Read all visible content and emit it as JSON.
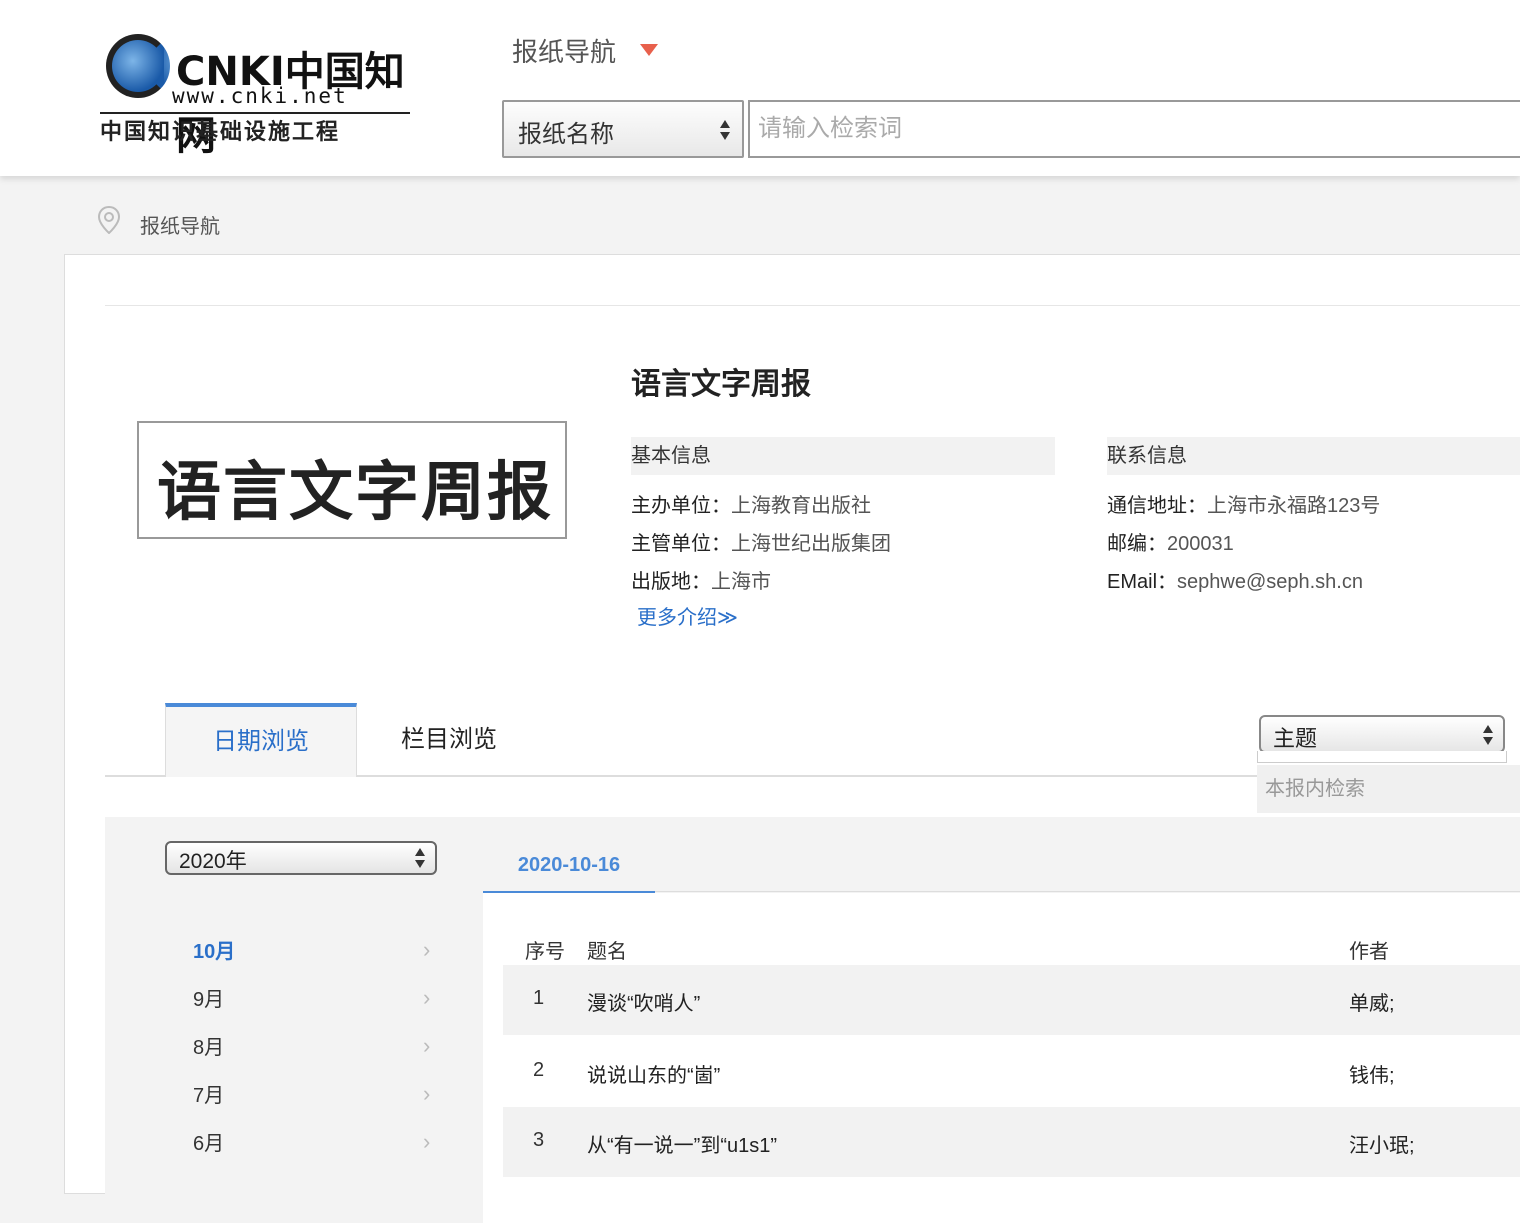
{
  "header": {
    "logo_brand": "CNKI中国知网",
    "logo_url": "www.cnki.net",
    "logo_subtitle": "中国知识基础设施工程",
    "nav_title": "报纸导航",
    "search_select_value": "报纸名称",
    "search_placeholder": "请输入检索词"
  },
  "breadcrumb": {
    "label": "报纸导航"
  },
  "paper": {
    "title": "语言文字周报",
    "cover_text": "语言文字周报",
    "basic_info": {
      "heading": "基本信息",
      "sponsor_label": "主办单位：",
      "sponsor": "上海教育出版社",
      "supervisor_label": "主管单位：",
      "supervisor": "上海世纪出版集团",
      "place_label": "出版地：",
      "place": "上海市"
    },
    "contact_info": {
      "heading": "联系信息",
      "address_label": "通信地址：",
      "address": "上海市永福路123号",
      "postcode_label": "邮编：",
      "postcode": "200031",
      "email_label": "EMail：",
      "email": "sephwe@seph.sh.cn"
    },
    "more_link": "更多介绍≫"
  },
  "tabs": {
    "date_browse": "日期浏览",
    "column_browse": "栏目浏览"
  },
  "inner_search": {
    "field_select": "主题",
    "placeholder": "本报内检索"
  },
  "browse": {
    "year_select": "2020年",
    "months": [
      {
        "label": "10月",
        "active": true
      },
      {
        "label": "9月",
        "active": false
      },
      {
        "label": "8月",
        "active": false
      },
      {
        "label": "7月",
        "active": false
      },
      {
        "label": "6月",
        "active": false
      }
    ],
    "date_tab": "2020-10-16",
    "columns": {
      "num": "序号",
      "title": "题名",
      "author": "作者"
    },
    "articles": [
      {
        "num": "1",
        "title": "漫谈“吹哨人”",
        "author": "单威;"
      },
      {
        "num": "2",
        "title": "说说山东的“崮”",
        "author": "钱伟;"
      },
      {
        "num": "3",
        "title": "从“有一说一”到“u1s1”",
        "author": "汪小珉;"
      }
    ]
  },
  "colors": {
    "accent": "#4a8ad8",
    "link": "#2a6fc9",
    "caret": "#e8604c"
  }
}
